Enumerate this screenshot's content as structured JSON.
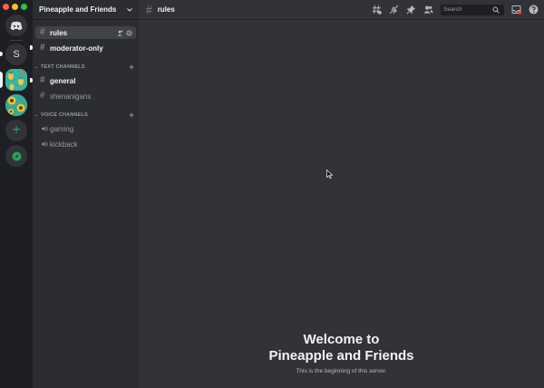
{
  "window": {
    "traffic_lights": [
      "#ff5f57",
      "#febc2e",
      "#28c840"
    ]
  },
  "servers": {
    "home_icon": "discord-logo-icon",
    "items": [
      {
        "name": "S-server",
        "label": "S"
      },
      {
        "name": "pineapple-server",
        "icon": "pineapple-pattern"
      },
      {
        "name": "sunflower-server",
        "icon": "sunflower-pattern"
      }
    ],
    "add_label": "+",
    "explore_icon": "compass-icon"
  },
  "guild": {
    "name": "Pineapple and Friends"
  },
  "channels": {
    "top": [
      {
        "label": "rules",
        "state": "selected"
      },
      {
        "label": "moderator-only",
        "state": "unread"
      }
    ],
    "text_category": "TEXT CHANNELS",
    "text": [
      {
        "label": "general",
        "state": "unread"
      },
      {
        "label": "shenanigans",
        "state": "muted"
      }
    ],
    "voice_category": "VOICE CHANNELS",
    "voice": [
      {
        "label": "gaming"
      },
      {
        "label": "kickback"
      }
    ]
  },
  "topbar": {
    "channel": "rules",
    "search_placeholder": "Search",
    "icons": [
      "threads-icon",
      "mute-bell-icon",
      "pin-icon",
      "members-icon",
      "inbox-icon",
      "help-icon"
    ]
  },
  "welcome": {
    "title_line1": "Welcome to",
    "title_line2": "Pineapple and Friends",
    "subtitle": "This is the beginning of this server."
  },
  "colors": {
    "accent": "#5865f2",
    "green": "#23a55a",
    "alert": "#f23f43"
  }
}
